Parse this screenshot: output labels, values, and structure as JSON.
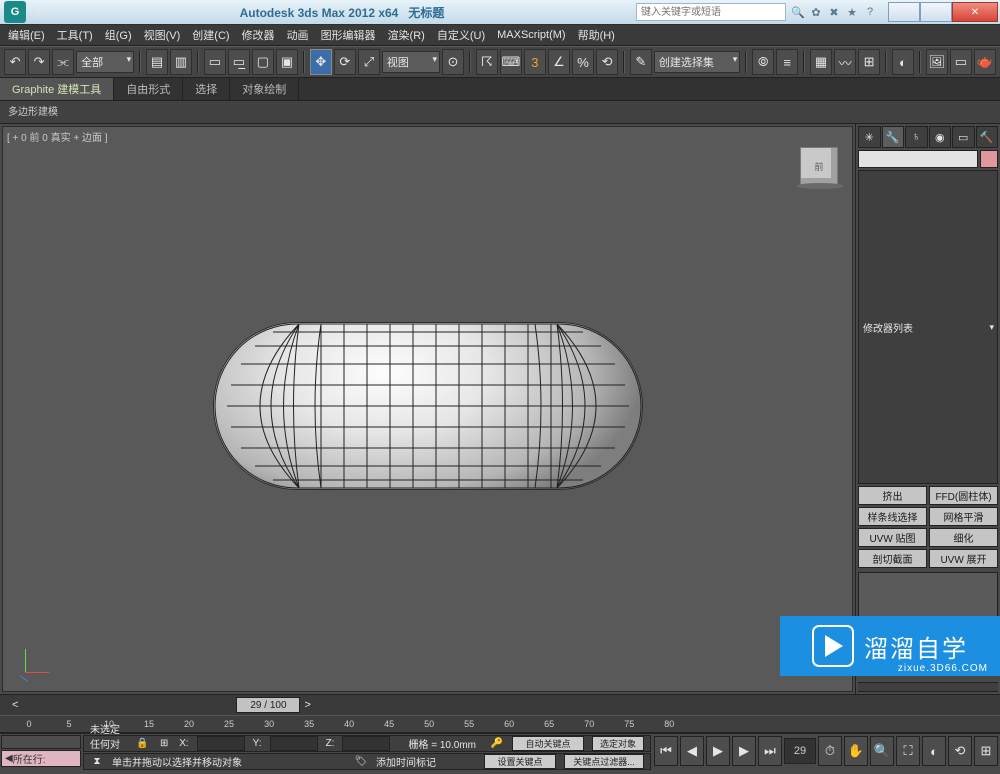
{
  "title": {
    "app": "Autodesk 3ds Max  2012 x64",
    "doc": "无标题"
  },
  "search_placeholder": "键入关键字或短语",
  "menu": [
    "编辑(E)",
    "工具(T)",
    "组(G)",
    "视图(V)",
    "创建(C)",
    "修改器",
    "动画",
    "图形编辑器",
    "渲染(R)",
    "自定义(U)",
    "MAXScript(M)",
    "帮助(H)"
  ],
  "toolbar": {
    "all": "全部",
    "view": "视图",
    "selset": "创建选择集"
  },
  "ribbon": {
    "tabs": [
      "Graphite 建模工具",
      "自由形式",
      "选择",
      "对象绘制"
    ],
    "sub": "多边形建模"
  },
  "viewport": {
    "label": "[ + 0 前 0 真实 + 边面 ]",
    "cube": "前"
  },
  "panel": {
    "modlist": "修改器列表",
    "btns": [
      [
        "挤出",
        "FFD(圆柱体)"
      ],
      [
        "样条线选择",
        "网格平滑"
      ],
      [
        "UVW 贴图",
        "细化"
      ],
      [
        "剖切截面",
        "UVW 展开"
      ]
    ],
    "stack_btns": [
      "⊟",
      "|‖|",
      "∀",
      "∂",
      "",
      "▦"
    ]
  },
  "time": {
    "slider": "29 / 100",
    "ticks": [
      "0",
      "5",
      "10",
      "15",
      "20",
      "25",
      "30",
      "35",
      "40",
      "45",
      "50",
      "55",
      "60",
      "65",
      "70",
      "75",
      "80"
    ]
  },
  "status": {
    "row_btn": "所在行:",
    "l1": "未选定任何对象",
    "l2": "单击并拖动以选择并移动对象",
    "grid": "栅格 = 10.0mm",
    "autokey": "自动关键点",
    "selsets": "选定对象",
    "setkey": "设置关键点",
    "keyfilter": "关键点过滤器...",
    "add_time": "添加时间标记",
    "frame": "29"
  },
  "watermark": {
    "brand": "溜溜自学",
    "sub": "zixue.3D66.COM"
  }
}
